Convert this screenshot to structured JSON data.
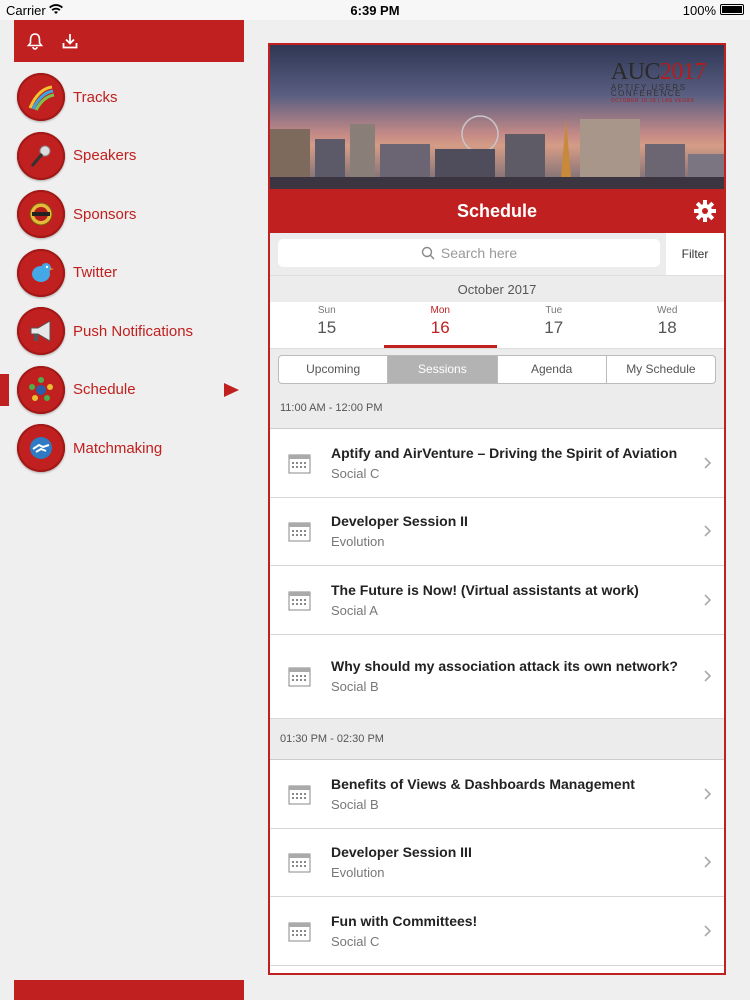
{
  "status": {
    "carrier": "Carrier",
    "time": "6:39 PM",
    "battery": "100%"
  },
  "sidebar": {
    "items": [
      {
        "label": "Tracks",
        "icon": "tracks-icon"
      },
      {
        "label": "Speakers",
        "icon": "microphone-icon"
      },
      {
        "label": "Sponsors",
        "icon": "sponsor-badge-icon"
      },
      {
        "label": "Twitter",
        "icon": "twitter-bird-icon"
      },
      {
        "label": "Push Notifications",
        "icon": "megaphone-icon"
      },
      {
        "label": "Schedule",
        "icon": "schedule-icon",
        "active": true
      },
      {
        "label": "Matchmaking",
        "icon": "handshake-icon"
      }
    ]
  },
  "banner": {
    "logo_line1a": "AUC",
    "logo_line1b": "2017",
    "logo_line2": "APTIFY USERS",
    "logo_line3": "CONFERENCE",
    "logo_line4": "OCTOBER 15-18 | LAS VEGAS"
  },
  "header": {
    "title": "Schedule"
  },
  "search": {
    "placeholder": "Search here",
    "filter_label": "Filter"
  },
  "calendar": {
    "month": "October 2017",
    "days": [
      {
        "name": "Sun",
        "num": "15"
      },
      {
        "name": "Mon",
        "num": "16",
        "active": true
      },
      {
        "name": "Tue",
        "num": "17"
      },
      {
        "name": "Wed",
        "num": "18"
      }
    ]
  },
  "segments": [
    "Upcoming",
    "Sessions",
    "Agenda",
    "My Schedule"
  ],
  "groups": [
    {
      "time": "11:00 AM - 12:00 PM",
      "sessions": [
        {
          "title": "Aptify and AirVenture – Driving the Spirit of Aviation",
          "room": "Social C"
        },
        {
          "title": "Developer Session II",
          "room": "Evolution"
        },
        {
          "title": "The Future is Now! (Virtual assistants at work)",
          "room": "Social A"
        },
        {
          "title": "Why should my association attack its own network?",
          "room": "Social B"
        }
      ]
    },
    {
      "time": "01:30 PM - 02:30 PM",
      "sessions": [
        {
          "title": "Benefits of Views & Dashboards Management",
          "room": "Social B"
        },
        {
          "title": "Developer Session III",
          "room": "Evolution"
        },
        {
          "title": "Fun with Committees!",
          "room": "Social C"
        }
      ]
    }
  ],
  "colors": {
    "accent": "#c0201f",
    "background": "#efefef"
  }
}
